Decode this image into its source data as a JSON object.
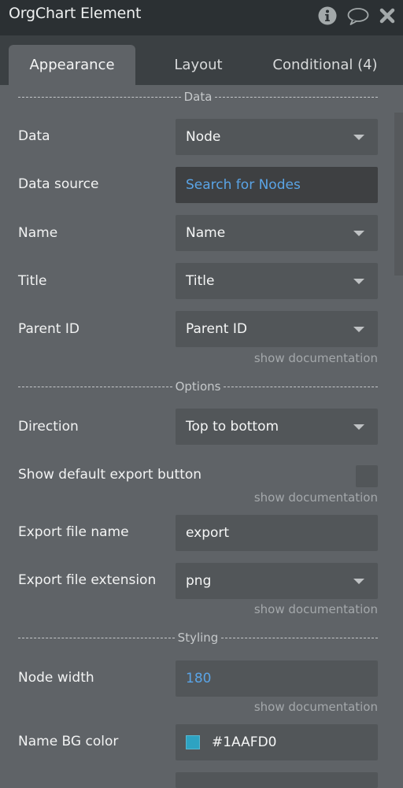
{
  "window": {
    "title": "OrgChart Element",
    "icons": [
      "info-icon",
      "comment-icon",
      "close-icon"
    ]
  },
  "tabs": [
    {
      "label": "Appearance",
      "active": true
    },
    {
      "label": "Layout",
      "active": false
    },
    {
      "label": "Conditional (4)",
      "active": false
    }
  ],
  "sections": {
    "data": "Data",
    "options": "Options",
    "styling": "Styling"
  },
  "fields": {
    "data": {
      "label": "Data",
      "value": "Node",
      "type": "dropdown"
    },
    "data_source": {
      "label": "Data source",
      "value": "Search for Nodes",
      "type": "expression"
    },
    "name": {
      "label": "Name",
      "value": "Name",
      "type": "dropdown"
    },
    "title": {
      "label": "Title",
      "value": "Title",
      "type": "dropdown"
    },
    "parent_id": {
      "label": "Parent ID",
      "value": "Parent ID",
      "type": "dropdown"
    },
    "direction": {
      "label": "Direction",
      "value": "Top to bottom",
      "type": "dropdown"
    },
    "show_export": {
      "label": "Show default export button",
      "checked": false,
      "type": "checkbox"
    },
    "export_name": {
      "label": "Export file name",
      "value": "export",
      "type": "text"
    },
    "export_ext": {
      "label": "Export file extension",
      "value": "png",
      "type": "dropdown"
    },
    "node_width": {
      "label": "Node width",
      "value": "180",
      "type": "number"
    },
    "name_bg": {
      "label": "Name BG color",
      "value": "#1AAFD0",
      "swatch": "#2ea3c2",
      "type": "color"
    }
  },
  "doc_link": "show documentation",
  "colors": {
    "accent_link": "#5aa4e6",
    "panel_bg": "#5f6367",
    "title_bg": "#2b3033"
  }
}
